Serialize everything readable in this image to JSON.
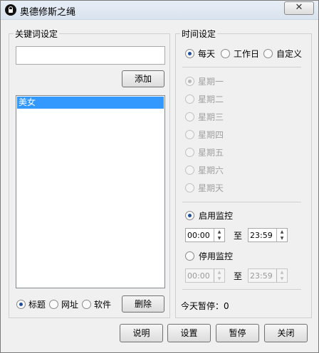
{
  "window": {
    "title": "奥德修斯之绳",
    "close_glyph": "✕"
  },
  "keywords": {
    "group_title": "关键词设定",
    "input_value": "",
    "add_label": "添加",
    "items": [
      "美女"
    ],
    "match_options": [
      "标题",
      "网址",
      "软件"
    ],
    "selected_match": "标题",
    "delete_label": "删除"
  },
  "time_settings": {
    "group_title": "时间设定",
    "modes": [
      "每天",
      "工作日",
      "自定义"
    ],
    "selected_mode": "每天",
    "weekdays": [
      "星期一",
      "星期二",
      "星期三",
      "星期四",
      "星期五",
      "星期六",
      "星期天"
    ],
    "selected_weekday": "星期一",
    "enable_label": "启用监控",
    "enable_from": "00:00",
    "enable_to": "23:59",
    "to_label": "至",
    "disable_label": "停用监控",
    "disable_from": "00:00",
    "disable_to": "23:59",
    "selected_monitor": "启用监控",
    "pause_today_text": "今天暂停：0"
  },
  "footer": {
    "help_label": "说明",
    "settings_label": "设置",
    "pause_label": "暂停",
    "close_label": "关闭"
  }
}
